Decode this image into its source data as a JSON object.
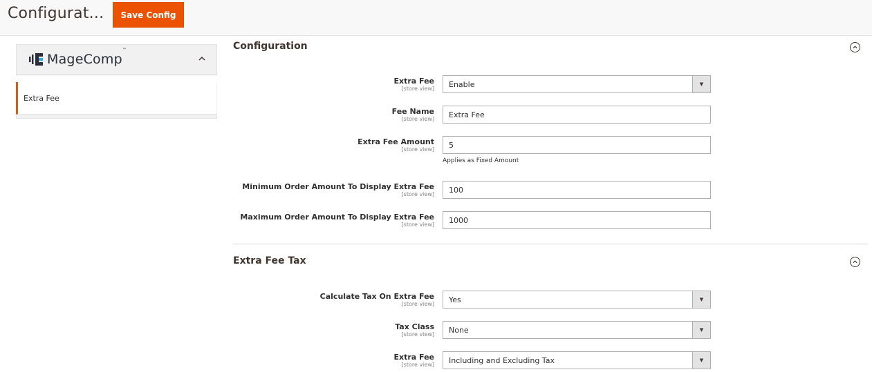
{
  "header": {
    "title": "Configurat...",
    "save_label": "Save Config"
  },
  "sidebar": {
    "brand": "MageComp",
    "brand_tm": "™",
    "items": [
      {
        "label": "Extra Fee"
      }
    ]
  },
  "sections": [
    {
      "title": "Configuration",
      "fields": [
        {
          "label": "Extra Fee",
          "scope": "[store view]",
          "type": "select",
          "value": "Enable"
        },
        {
          "label": "Fee Name",
          "scope": "[store view]",
          "type": "text",
          "value": "Extra Fee"
        },
        {
          "label": "Extra Fee Amount",
          "scope": "[store view]",
          "type": "text",
          "value": "5",
          "note": "Applies as Fixed Amount"
        },
        {
          "label": "Minimum Order Amount To Display Extra Fee",
          "scope": "[store view]",
          "type": "text",
          "value": "100"
        },
        {
          "label": "Maximum Order Amount To Display Extra Fee",
          "scope": "[store view]",
          "type": "text",
          "value": "1000"
        }
      ]
    },
    {
      "title": "Extra Fee Tax",
      "fields": [
        {
          "label": "Calculate Tax On Extra Fee",
          "scope": "[store view]",
          "type": "select",
          "value": "Yes"
        },
        {
          "label": "Tax Class",
          "scope": "[store view]",
          "type": "select",
          "value": "None"
        },
        {
          "label": "Extra Fee",
          "scope": "[store view]",
          "type": "select",
          "value": "Including and Excluding Tax"
        }
      ]
    }
  ],
  "colors": {
    "accent": "#eb5202",
    "header_bg": "#f8f8f8",
    "border": "#adadad"
  }
}
